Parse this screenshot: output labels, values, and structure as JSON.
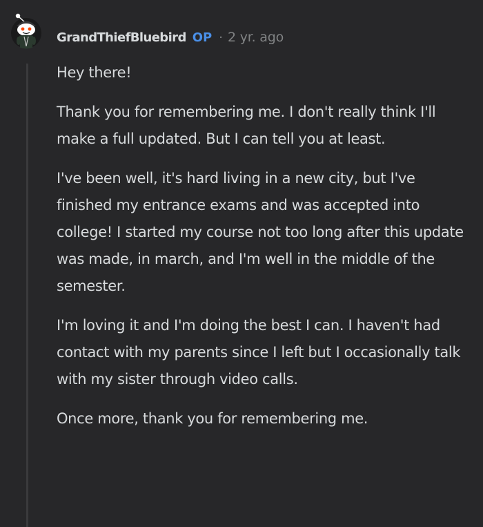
{
  "comment": {
    "avatar": "reddit-snoo-avatar",
    "username": "GrandThiefBluebird",
    "op_label": "OP",
    "separator": "·",
    "timestamp": "2 yr. ago",
    "paragraphs": [
      "Hey there!",
      "Thank you for remembering me. I don't really think I'll make a full updated. But I can tell you at least.",
      "I've been well, it's hard living in a new city, but I've finished my entrance exams and was accepted into college! I started my course not too long after this update was made, in march, and I'm well in the middle of the semester.",
      "I'm loving it and I'm doing the best I can. I haven't had contact with my parents since I left but I occasionally talk with my sister through video calls.",
      "Once more, thank you for remembering me."
    ]
  },
  "colors": {
    "background": "#272729",
    "text": "#d7dadc",
    "op": "#4a8fe7",
    "meta": "#818384",
    "thread_line": "#3a3a3c"
  }
}
